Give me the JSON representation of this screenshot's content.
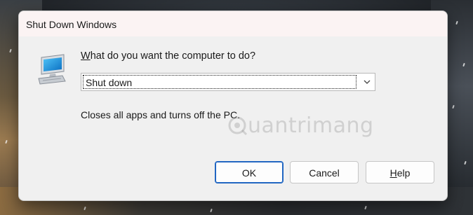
{
  "dialog": {
    "title": "Shut Down Windows",
    "question_underlined": "W",
    "question_rest": "hat do you want the computer to do?",
    "selected_action": "Shut down",
    "description": "Closes all apps and turns off the PC.",
    "watermark": "uantrimang",
    "buttons": {
      "ok": "OK",
      "cancel": "Cancel",
      "help_underlined": "H",
      "help_rest": "elp"
    }
  },
  "icons": {
    "computer": "computer-icon",
    "dropdown": "chevron-down-icon",
    "watermark_logo": "quantrimang-logo-icon"
  },
  "colors": {
    "focus_border": "#2166c2",
    "dialog_bg": "#f0f0f0",
    "titlebar_bg": "#fbf3f3"
  }
}
